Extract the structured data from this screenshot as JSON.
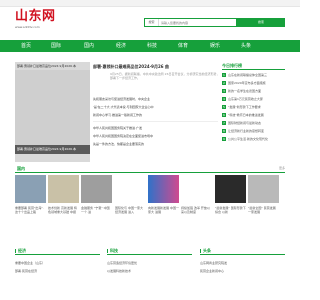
{
  "colors": {
    "brand": "#16a03b",
    "logo": "#d1101f",
    "header_bg": "#f3f3f3"
  },
  "topbar": {
    "right_link": ""
  },
  "logo": {
    "name": "山东网",
    "url": "www.sdnttv.com"
  },
  "search": {
    "type_label": "搜索",
    "placeholder": "请输入您要找的内容",
    "button_label": "搜索"
  },
  "nav": {
    "items": [
      "首页",
      "国际",
      "国内",
      "经济",
      "科技",
      "体育",
      "娱乐",
      "头条"
    ]
  },
  "slider": {
    "top_caption": "部署·惠领补口最难高品位2024·9月2026·本",
    "bottom_caption": "部署·惠领补口最难高品位2024·9月2026·本",
    "dots": "..."
  },
  "headline": {
    "title": "部署·惠领补口最难高品位2024·9月26 曲",
    "summary": "9月25日，据新闻联播，中共中央政治局 26日召开会议，分析研究当前经济形势，部署下一步经济工作。"
  },
  "news_list": [
    "先和朋友采访与促进经济发展时，中央企业",
    "'是'在二十大·大代表本说·与到国家大企业心中",
    "新闻中心学习·推进第一版新闻工作的",
    "中华人民共和国国务院关于推进·广发",
    "中华人民共和国国务院决定在全面促进市场中",
    "先是一件的方法，快都是企业要落实的"
  ],
  "rank": {
    "title": "今日排行榜",
    "items": [
      "山东在新闻联播总体全国第三",
      "国家2020年宣布多方面措施",
      "新的一名学生在德国方面",
      "山东第1万元民营收之大厦",
      "\"发展\"新形势下工作要求",
      "\"科技\"教育日本的推进发展",
      "国际财经新闻与最新动态",
      "让经济新行业新的思想转变",
      "公共公平生活·新的文化现代化"
    ]
  },
  "section_domestic": {
    "title": "国内",
    "more": "更多"
  },
  "domestic_thumbs": [
    {
      "caption": "重要部署 民营\"出海\"·这十个出品上路"
    },
    {
      "caption": "技术创新 高新发展 特色领域重大基础 中报"
    },
    {
      "caption": "金融服务 \"宁夏\" 中国 一个·进"
    },
    {
      "caption": "国际化与 中国一家大 经济发展 进入"
    },
    {
      "caption": "向新发展新发展 中国一家大 进展"
    },
    {
      "caption": "持续加强 改革 开放以来以及制度"
    },
    {
      "caption": "\"最新发展\" 国际形势下综合 以新"
    },
    {
      "caption": "\"最新全国\" 民营发展 一家发展"
    }
  ],
  "sub_sections": [
    {
      "title": "经济",
      "lines": [
        "重要中国企业（山东）",
        "部署·民营在经济"
      ]
    },
    {
      "title": "科技",
      "lines": [
        "山东营造经济环境更优",
        "以发展科技新技术"
      ]
    },
    {
      "title": "头条",
      "lines": [
        "山东网商业研究院发",
        "民营企业新闻中心"
      ]
    }
  ]
}
